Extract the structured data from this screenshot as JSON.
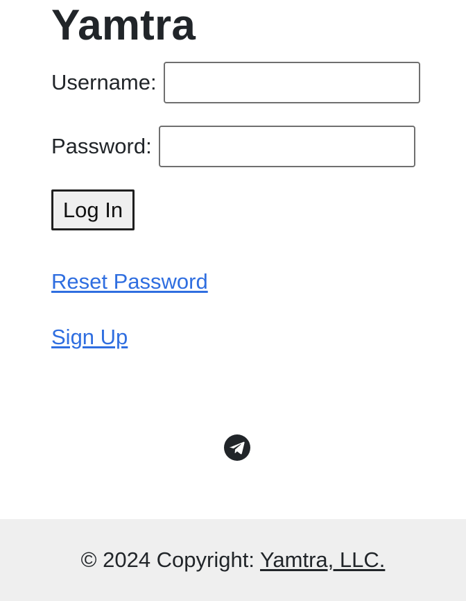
{
  "app": {
    "title": "Yamtra"
  },
  "form": {
    "username_label": "Username:",
    "username_value": "",
    "password_label": "Password:",
    "password_value": "",
    "login_button": "Log In"
  },
  "links": {
    "reset_password": "Reset Password",
    "sign_up": "Sign Up"
  },
  "social": {
    "telegram_icon": "telegram-icon"
  },
  "footer": {
    "copyright_prefix": "© 2024 Copyright:",
    "company_link": "Yamtra, LLC."
  },
  "colors": {
    "text": "#212529",
    "link": "#2f6ee0",
    "footer_bg": "#efefef",
    "button_bg": "#efefef"
  }
}
